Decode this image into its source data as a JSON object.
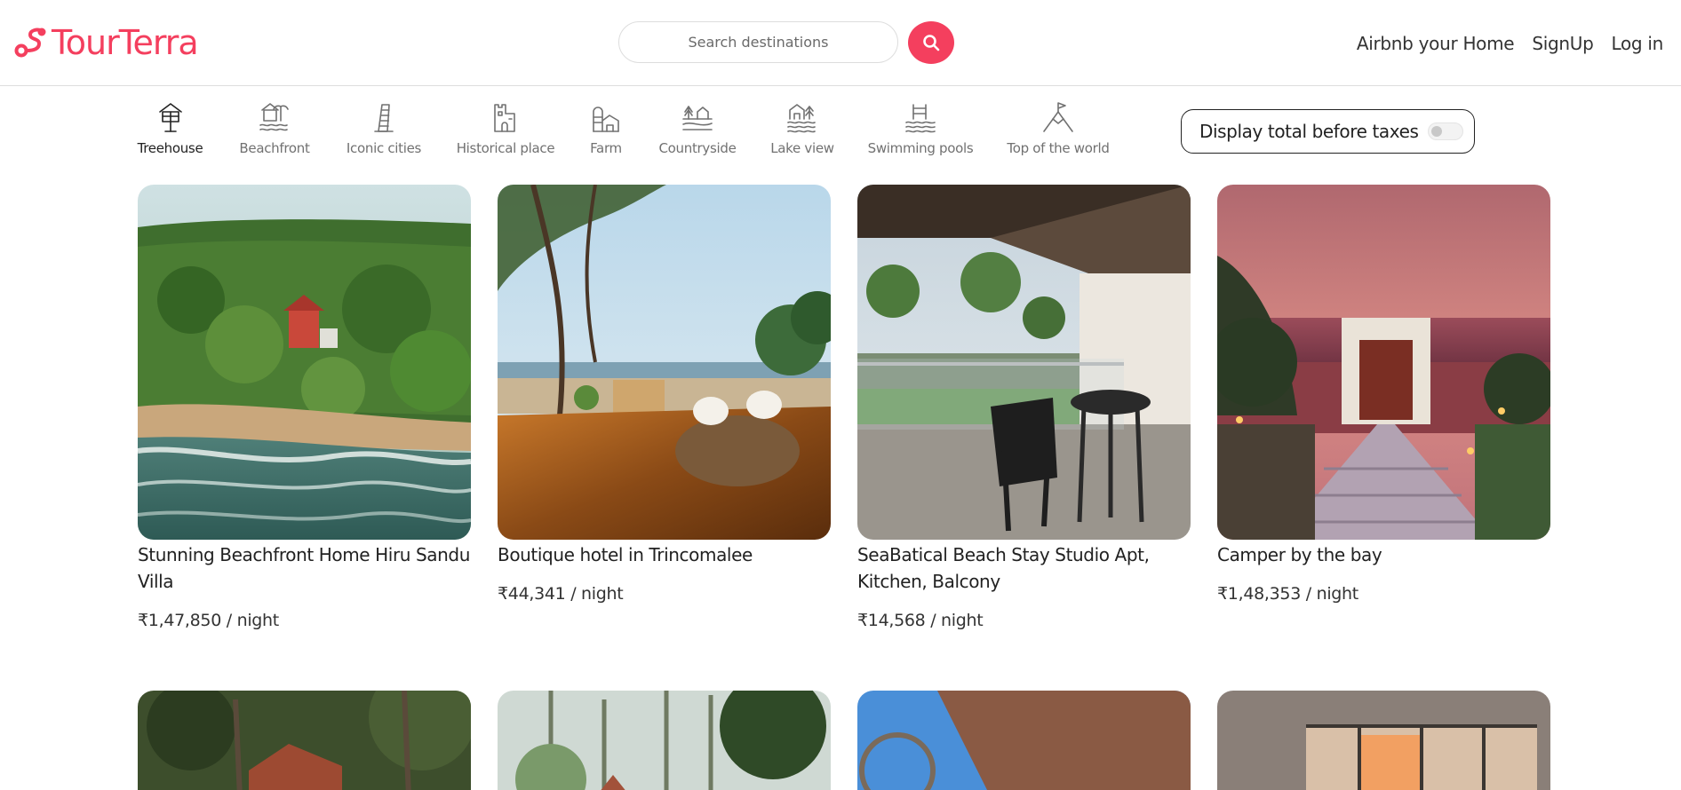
{
  "brand": {
    "name": "TourTerra",
    "color": "#f43f5e"
  },
  "search": {
    "placeholder": "Search destinations",
    "button_icon": "search-icon"
  },
  "nav": {
    "host_link": "Airbnb your Home",
    "signup": "SignUp",
    "login": "Log in"
  },
  "categories": [
    {
      "label": "Treehouse",
      "icon": "treehouse-icon",
      "active": true
    },
    {
      "label": "Beachfront",
      "icon": "beachfront-icon",
      "active": false
    },
    {
      "label": "Iconic cities",
      "icon": "leaning-tower-icon",
      "active": false
    },
    {
      "label": "Historical place",
      "icon": "castle-icon",
      "active": false
    },
    {
      "label": "Farm",
      "icon": "farm-icon",
      "active": false
    },
    {
      "label": "Countryside",
      "icon": "countryside-icon",
      "active": false
    },
    {
      "label": "Lake view",
      "icon": "lake-view-icon",
      "active": false
    },
    {
      "label": "Swimming pools",
      "icon": "pool-icon",
      "active": false
    },
    {
      "label": "Top of the world",
      "icon": "mountain-flag-icon",
      "active": false
    }
  ],
  "taxes_toggle": {
    "label": "Display total before taxes",
    "enabled": false
  },
  "listings": [
    {
      "title": "Stunning Beachfront Home Hiru Sandu Villa",
      "price": "₹1,47,850 / night"
    },
    {
      "title": "Boutique hotel in Trincomalee",
      "price": "₹44,341 / night"
    },
    {
      "title": "SeaBatical Beach Stay Studio Apt, Kitchen, Balcony",
      "price": "₹14,568 / night"
    },
    {
      "title": "Camper by the bay",
      "price": "₹1,48,353 / night"
    }
  ]
}
